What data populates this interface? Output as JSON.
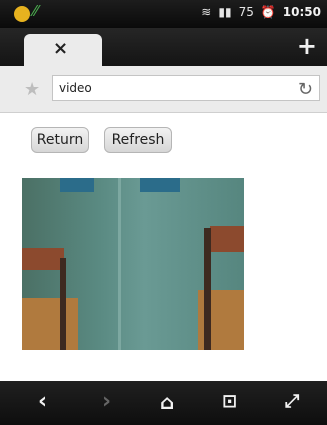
{
  "status_bar": {
    "time": "10:50",
    "icons": [
      "notification-icon",
      "notification-icon",
      "wifi-icon",
      "signal-icon",
      "battery-icon",
      "alarm-icon"
    ],
    "battery_level": "75"
  },
  "browser": {
    "tab": {
      "close_glyph": "×"
    },
    "new_tab_glyph": "+",
    "url_value": "video",
    "reload_glyph": "↻",
    "star_glyph": "★"
  },
  "page": {
    "return_label": "Return",
    "refresh_label": "Refresh"
  },
  "nav_bar": {
    "back": "‹",
    "forward": "›",
    "home": "⌂",
    "bookmarks": "⊡",
    "fullscreen": "⤢"
  }
}
